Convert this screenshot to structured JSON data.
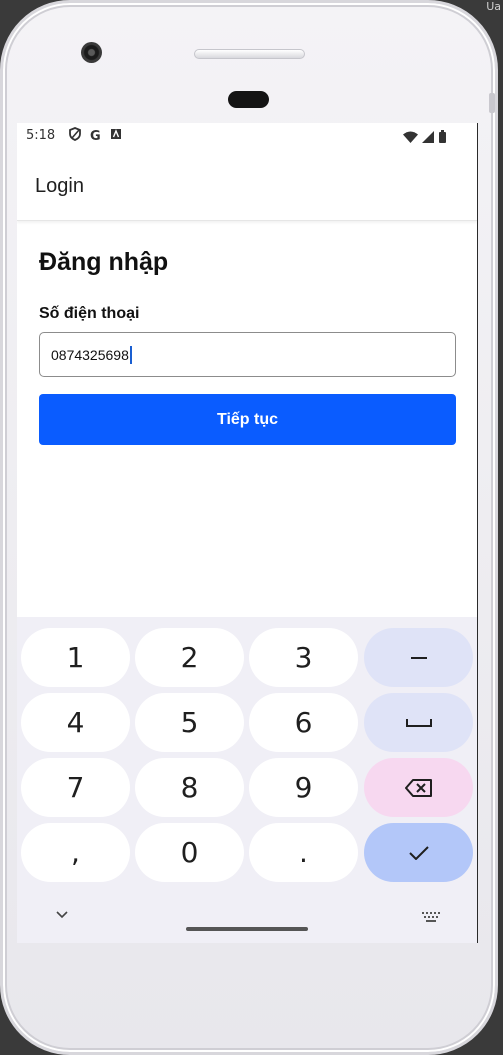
{
  "status": {
    "time": "5:18",
    "icons_left": [
      "shield-icon",
      "google-icon",
      "a-box-icon"
    ],
    "icons_right": [
      "wifi-icon",
      "signal-icon",
      "battery-icon"
    ]
  },
  "appbar": {
    "title": "Login"
  },
  "form": {
    "heading": "Đăng nhập",
    "phone_label": "Số điện thoại",
    "phone_value": "0874325698",
    "submit_label": "Tiếp tục"
  },
  "keyboard": {
    "rows": [
      [
        "1",
        "2",
        "3",
        "–"
      ],
      [
        "4",
        "5",
        "6",
        "␣"
      ],
      [
        "7",
        "8",
        "9",
        "⌫"
      ],
      [
        ",",
        "0",
        ".",
        "✓"
      ]
    ]
  },
  "colors": {
    "primary": "#0a5cff",
    "keyboard_bg": "#f0eff6",
    "func_key": "#dfe3f7",
    "delete_key": "#f7d8f0",
    "done_key": "#b3c7f9"
  }
}
